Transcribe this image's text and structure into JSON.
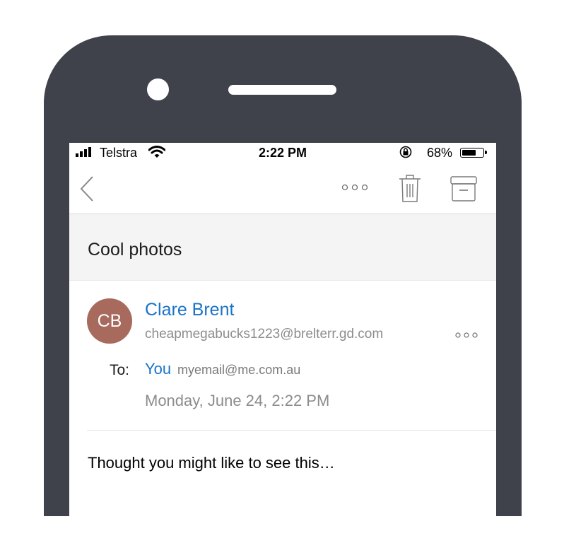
{
  "status_bar": {
    "carrier": "Telstra",
    "time": "2:22 PM",
    "battery_percent": "68%",
    "battery_level": 0.68
  },
  "toolbar": {
    "back_icon": "chevron-left-icon",
    "more_icon": "more-horizontal-icon",
    "delete_icon": "trash-icon",
    "archive_icon": "archive-icon"
  },
  "email": {
    "subject": "Cool photos",
    "sender": {
      "initials": "CB",
      "name": "Clare Brent",
      "email": "cheapmegabucks1223@brelterr.gd.com",
      "avatar_color": "#a76a5d"
    },
    "to_label": "To:",
    "recipient": {
      "name": "You",
      "email": "myemail@me.com.au"
    },
    "date": "Monday, June 24, 2:22 PM",
    "body": "Thought you might like to see this…"
  },
  "colors": {
    "link_blue": "#1a73c8",
    "device_frame": "#3f414b"
  }
}
